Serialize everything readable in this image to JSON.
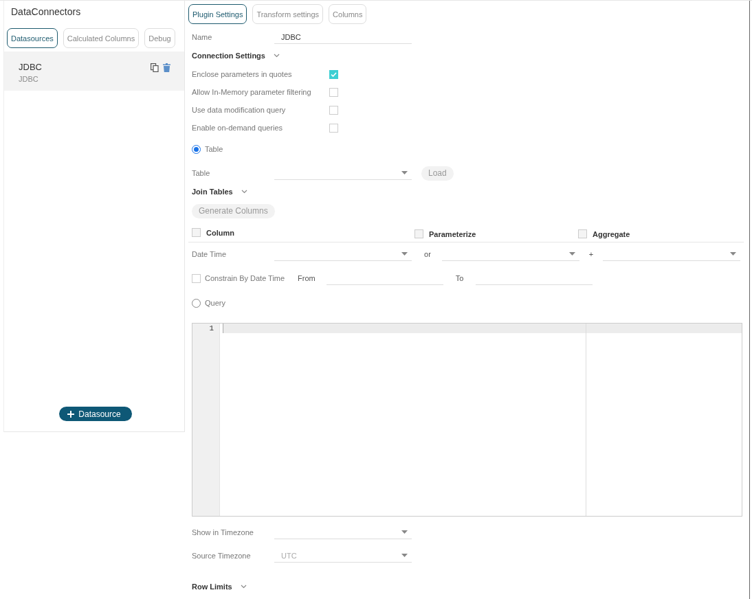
{
  "sidebar": {
    "title": "DataConnectors",
    "tabs": [
      {
        "label": "Datasources",
        "selected": true
      },
      {
        "label": "Calculated Columns",
        "selected": false
      },
      {
        "label": "Debug",
        "selected": false
      }
    ],
    "items": [
      {
        "name": "JDBC",
        "type": "JDBC",
        "selected": true
      }
    ],
    "add_button": "Datasource"
  },
  "main": {
    "tabs": [
      {
        "label": "Plugin Settings",
        "selected": true
      },
      {
        "label": "Transform settings",
        "selected": false
      },
      {
        "label": "Columns",
        "selected": false
      }
    ],
    "name_field": {
      "label": "Name",
      "value": "JDBC"
    },
    "connection_settings": "Connection Settings",
    "options": [
      {
        "label": "Enclose parameters in quotes",
        "checked": true
      },
      {
        "label": "Allow In-Memory parameter filtering",
        "checked": false
      },
      {
        "label": "Use data modification query",
        "checked": false
      },
      {
        "label": "Enable on-demand queries",
        "checked": false
      }
    ],
    "table_mode": {
      "label": "Table",
      "selected": true
    },
    "table_field": {
      "label": "Table",
      "load_button": "Load"
    },
    "join_tables": "Join Tables",
    "generate_button": "Generate Columns",
    "column_header": [
      {
        "label": "Column",
        "checked": false
      },
      {
        "label": "Parameterize",
        "checked": false
      },
      {
        "label": "Aggregate",
        "checked": false
      }
    ],
    "date_time": {
      "label": "Date Time",
      "or": "or",
      "plus": "+"
    },
    "constrain": {
      "label": "Constrain By Date Time",
      "checked": false,
      "from": "From",
      "to": "To"
    },
    "query_mode": {
      "label": "Query",
      "selected": false
    },
    "editor": {
      "line_numbers": [
        "1"
      ]
    },
    "show_timezone": {
      "label": "Show in Timezone"
    },
    "source_timezone": {
      "label": "Source Timezone",
      "value": "UTC"
    },
    "row_limits": "Row Limits"
  }
}
